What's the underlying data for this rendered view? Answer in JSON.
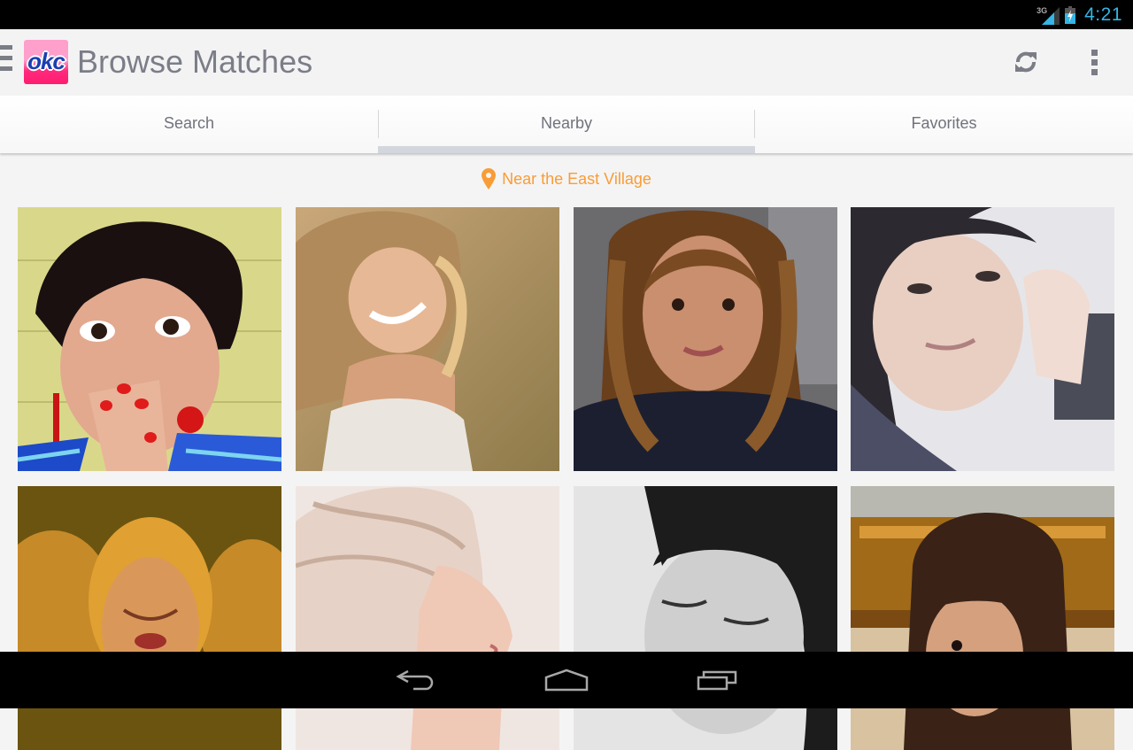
{
  "status_bar": {
    "network_type": "3G",
    "time": "4:21",
    "icons": [
      "signal-icon",
      "battery-charging-icon"
    ],
    "accent_color": "#33b5e5"
  },
  "action_bar": {
    "logo_text": "okc",
    "title": "Browse Matches",
    "actions": [
      {
        "name": "refresh",
        "icon": "refresh-icon"
      },
      {
        "name": "overflow",
        "icon": "overflow-menu-icon"
      }
    ]
  },
  "tabs": [
    {
      "label": "Search",
      "active": false
    },
    {
      "label": "Nearby",
      "active": true
    },
    {
      "label": "Favorites",
      "active": false
    }
  ],
  "location": {
    "icon": "map-pin-icon",
    "label": "Near the East Village",
    "color": "#f99c36"
  },
  "matches": [
    {
      "photo": "woman with dark hair covering mouth, red earrings, yellow wall"
    },
    {
      "photo": "smiling blonde woman leaning forward, field background"
    },
    {
      "photo": "woman with long auburn hair, freckles, dark top"
    },
    {
      "photo": "dark-haired woman resting head on hand, close-up"
    },
    {
      "photo": "blonde woman reflected in mirrors, golden tint"
    },
    {
      "photo": "platinum blonde woman in profile"
    },
    {
      "photo": "black and white photo of woman with short dark hair looking down"
    },
    {
      "photo": "woman with bob haircut in front of ornate gold mirror"
    }
  ],
  "nav_bar": {
    "buttons": [
      {
        "name": "back",
        "icon": "back-icon"
      },
      {
        "name": "home",
        "icon": "home-icon"
      },
      {
        "name": "recents",
        "icon": "recent-apps-icon"
      }
    ]
  }
}
